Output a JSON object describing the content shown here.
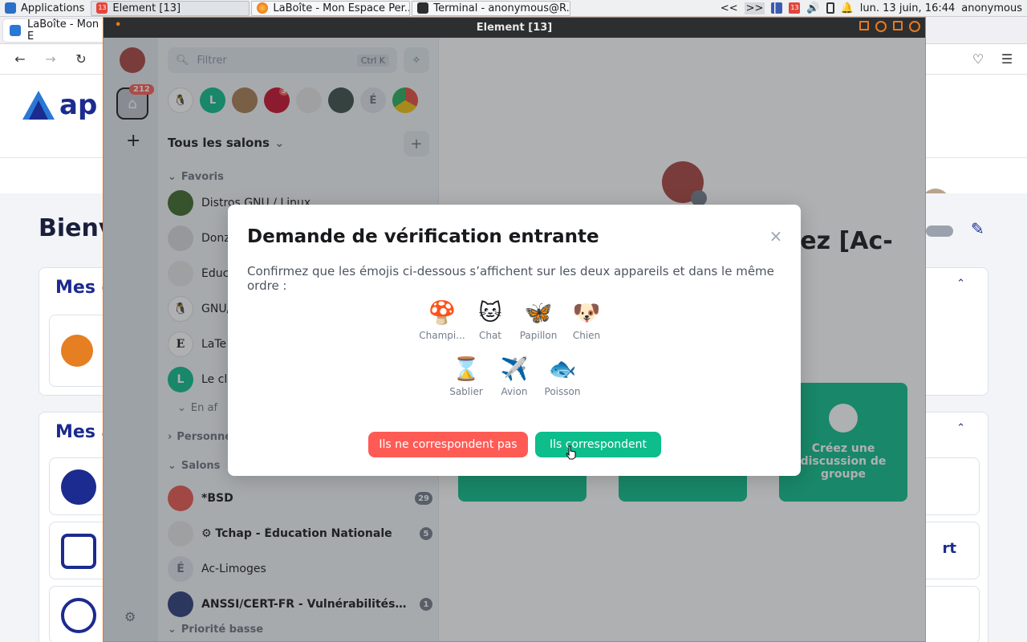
{
  "taskbar": {
    "apps_label": "Applications",
    "tasks": [
      {
        "label": "Element [13]",
        "badge": "13"
      },
      {
        "label": "LaBoîte - Mon Espace Per..."
      },
      {
        "label": "Terminal - anonymous@R..."
      }
    ],
    "nav_arrows": "<<",
    "nav_arrows2": ">>",
    "tray_badge": "13",
    "datetime": "lun. 13 juin, 16:44",
    "user": "anonymous"
  },
  "firefox": {
    "tab_label": "LaBoîte - Mon E",
    "logo_text": "ap",
    "welcome": "Bienv",
    "section1": "Mes g",
    "section2": "Mes a",
    "link_text": "rt"
  },
  "element": {
    "window_title": "Element [13]",
    "spaces": {
      "home_badge": "212",
      "add_label": "+"
    },
    "roomlist": {
      "search_placeholder": "Filtrer",
      "search_shortcut": "Ctrl K",
      "title": "Tous les salons",
      "favourites_label": "Favoris",
      "favourites": [
        {
          "name": "Distros GNU / Linux"
        },
        {
          "name": "Donz"
        },
        {
          "name": "Éduc"
        },
        {
          "name": "GNU/"
        },
        {
          "name": "LaTe"
        },
        {
          "name": "Le cl"
        }
      ],
      "show_more": "En af",
      "people_label": "Personne",
      "rooms_label": "Salons",
      "rooms": [
        {
          "name": "*BSD",
          "count": "29"
        },
        {
          "name": "⚙ Tchap - Éducation Nationale",
          "count": "5"
        },
        {
          "name": "Ac-Limoges",
          "count": ""
        },
        {
          "name": "ANSSI/CERT-FR - Vulnérabilités & Al...",
          "count": "1"
        }
      ],
      "low_priority_label": "Priorité basse",
      "breadcrumb_badge": "3"
    },
    "home": {
      "welcome_fragment": "lez [Ac-",
      "tile3_label": "Créez une discussion de groupe"
    }
  },
  "dialog": {
    "title": "Demande de vérification entrante",
    "description": "Confirmez que les émojis ci-dessous s’affichent sur les deux appareils et dans le même ordre :",
    "emojis_row1": [
      {
        "glyph": "🍄",
        "label": "Champi..."
      },
      {
        "glyph": "🐱",
        "label": "Chat"
      },
      {
        "glyph": "🦋",
        "label": "Papillon"
      },
      {
        "glyph": "🐶",
        "label": "Chien"
      }
    ],
    "emojis_row2": [
      {
        "glyph": "⌛",
        "label": "Sablier"
      },
      {
        "glyph": "✈️",
        "label": "Avion"
      },
      {
        "glyph": "🐟",
        "label": "Poisson"
      }
    ],
    "mismatch_button": "Ils ne correspondent pas",
    "match_button": "Ils correspondent",
    "close_glyph": "×"
  },
  "colors": {
    "accent_green": "#0dbd8b",
    "danger_red": "#ff5b55",
    "window_border": "#e8781e"
  }
}
